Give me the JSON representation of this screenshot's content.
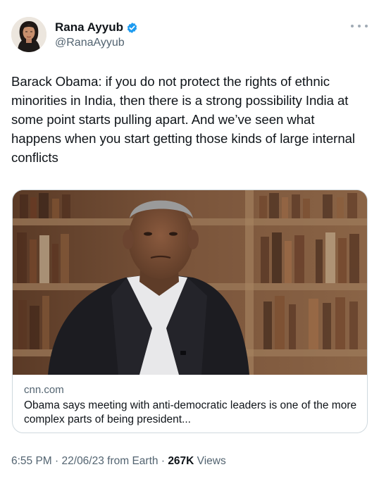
{
  "author": {
    "display_name": "Rana Ayyub",
    "handle": "@RanaAyyub",
    "verified_icon": "verified-badge-icon",
    "avatar_icon": "user-avatar"
  },
  "more_icon": "more-options-icon",
  "tweet": {
    "text": "Barack Obama: if you do not protect the rights of ethnic minorities in India, then there is a strong possibility India at some point starts pulling apart. And we’ve seen what happens when you start getting those kinds of large internal conflicts"
  },
  "link_card": {
    "domain": "cnn.com",
    "title": "Obama says meeting with anti-democratic leaders is one of the more complex parts of being president..."
  },
  "footer": {
    "time": "6:55 PM",
    "sep1": " · ",
    "date": "22/06/23",
    "source": " from Earth",
    "sep2": " · ",
    "views_count": "267K",
    "views_label": " Views"
  },
  "colors": {
    "verified": "#1d9bf0",
    "text": "#0f1419",
    "muted": "#536471",
    "border": "#cfd9de"
  }
}
